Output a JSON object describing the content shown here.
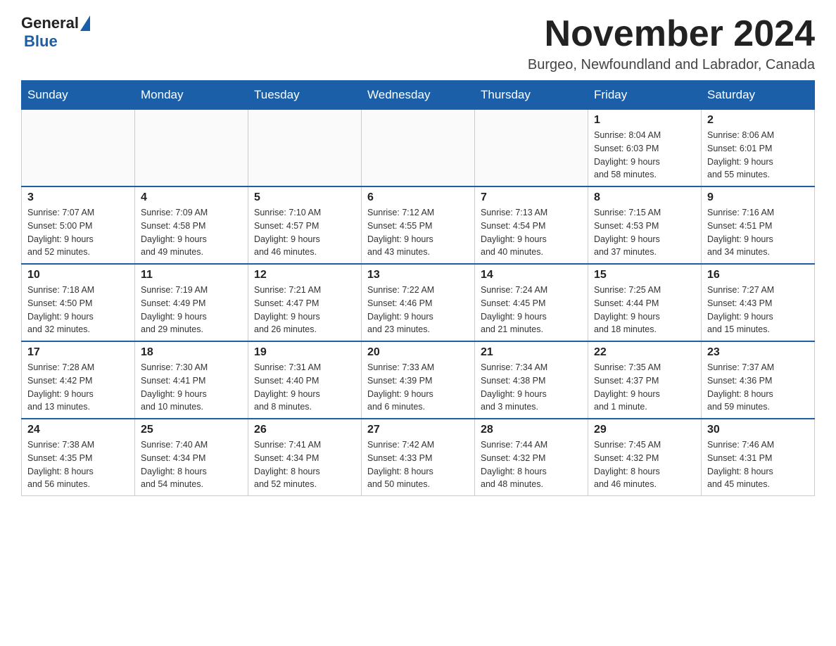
{
  "logo": {
    "text_general": "General",
    "text_blue": "Blue"
  },
  "title": "November 2024",
  "location": "Burgeo, Newfoundland and Labrador, Canada",
  "weekdays": [
    "Sunday",
    "Monday",
    "Tuesday",
    "Wednesday",
    "Thursday",
    "Friday",
    "Saturday"
  ],
  "weeks": [
    [
      {
        "day": "",
        "info": ""
      },
      {
        "day": "",
        "info": ""
      },
      {
        "day": "",
        "info": ""
      },
      {
        "day": "",
        "info": ""
      },
      {
        "day": "",
        "info": ""
      },
      {
        "day": "1",
        "info": "Sunrise: 8:04 AM\nSunset: 6:03 PM\nDaylight: 9 hours\nand 58 minutes."
      },
      {
        "day": "2",
        "info": "Sunrise: 8:06 AM\nSunset: 6:01 PM\nDaylight: 9 hours\nand 55 minutes."
      }
    ],
    [
      {
        "day": "3",
        "info": "Sunrise: 7:07 AM\nSunset: 5:00 PM\nDaylight: 9 hours\nand 52 minutes."
      },
      {
        "day": "4",
        "info": "Sunrise: 7:09 AM\nSunset: 4:58 PM\nDaylight: 9 hours\nand 49 minutes."
      },
      {
        "day": "5",
        "info": "Sunrise: 7:10 AM\nSunset: 4:57 PM\nDaylight: 9 hours\nand 46 minutes."
      },
      {
        "day": "6",
        "info": "Sunrise: 7:12 AM\nSunset: 4:55 PM\nDaylight: 9 hours\nand 43 minutes."
      },
      {
        "day": "7",
        "info": "Sunrise: 7:13 AM\nSunset: 4:54 PM\nDaylight: 9 hours\nand 40 minutes."
      },
      {
        "day": "8",
        "info": "Sunrise: 7:15 AM\nSunset: 4:53 PM\nDaylight: 9 hours\nand 37 minutes."
      },
      {
        "day": "9",
        "info": "Sunrise: 7:16 AM\nSunset: 4:51 PM\nDaylight: 9 hours\nand 34 minutes."
      }
    ],
    [
      {
        "day": "10",
        "info": "Sunrise: 7:18 AM\nSunset: 4:50 PM\nDaylight: 9 hours\nand 32 minutes."
      },
      {
        "day": "11",
        "info": "Sunrise: 7:19 AM\nSunset: 4:49 PM\nDaylight: 9 hours\nand 29 minutes."
      },
      {
        "day": "12",
        "info": "Sunrise: 7:21 AM\nSunset: 4:47 PM\nDaylight: 9 hours\nand 26 minutes."
      },
      {
        "day": "13",
        "info": "Sunrise: 7:22 AM\nSunset: 4:46 PM\nDaylight: 9 hours\nand 23 minutes."
      },
      {
        "day": "14",
        "info": "Sunrise: 7:24 AM\nSunset: 4:45 PM\nDaylight: 9 hours\nand 21 minutes."
      },
      {
        "day": "15",
        "info": "Sunrise: 7:25 AM\nSunset: 4:44 PM\nDaylight: 9 hours\nand 18 minutes."
      },
      {
        "day": "16",
        "info": "Sunrise: 7:27 AM\nSunset: 4:43 PM\nDaylight: 9 hours\nand 15 minutes."
      }
    ],
    [
      {
        "day": "17",
        "info": "Sunrise: 7:28 AM\nSunset: 4:42 PM\nDaylight: 9 hours\nand 13 minutes."
      },
      {
        "day": "18",
        "info": "Sunrise: 7:30 AM\nSunset: 4:41 PM\nDaylight: 9 hours\nand 10 minutes."
      },
      {
        "day": "19",
        "info": "Sunrise: 7:31 AM\nSunset: 4:40 PM\nDaylight: 9 hours\nand 8 minutes."
      },
      {
        "day": "20",
        "info": "Sunrise: 7:33 AM\nSunset: 4:39 PM\nDaylight: 9 hours\nand 6 minutes."
      },
      {
        "day": "21",
        "info": "Sunrise: 7:34 AM\nSunset: 4:38 PM\nDaylight: 9 hours\nand 3 minutes."
      },
      {
        "day": "22",
        "info": "Sunrise: 7:35 AM\nSunset: 4:37 PM\nDaylight: 9 hours\nand 1 minute."
      },
      {
        "day": "23",
        "info": "Sunrise: 7:37 AM\nSunset: 4:36 PM\nDaylight: 8 hours\nand 59 minutes."
      }
    ],
    [
      {
        "day": "24",
        "info": "Sunrise: 7:38 AM\nSunset: 4:35 PM\nDaylight: 8 hours\nand 56 minutes."
      },
      {
        "day": "25",
        "info": "Sunrise: 7:40 AM\nSunset: 4:34 PM\nDaylight: 8 hours\nand 54 minutes."
      },
      {
        "day": "26",
        "info": "Sunrise: 7:41 AM\nSunset: 4:34 PM\nDaylight: 8 hours\nand 52 minutes."
      },
      {
        "day": "27",
        "info": "Sunrise: 7:42 AM\nSunset: 4:33 PM\nDaylight: 8 hours\nand 50 minutes."
      },
      {
        "day": "28",
        "info": "Sunrise: 7:44 AM\nSunset: 4:32 PM\nDaylight: 8 hours\nand 48 minutes."
      },
      {
        "day": "29",
        "info": "Sunrise: 7:45 AM\nSunset: 4:32 PM\nDaylight: 8 hours\nand 46 minutes."
      },
      {
        "day": "30",
        "info": "Sunrise: 7:46 AM\nSunset: 4:31 PM\nDaylight: 8 hours\nand 45 minutes."
      }
    ]
  ]
}
